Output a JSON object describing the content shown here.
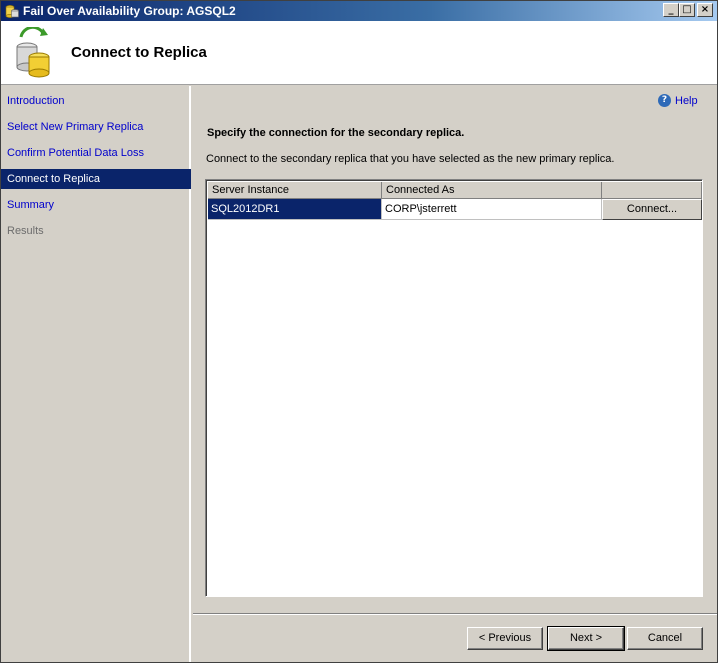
{
  "window": {
    "title": "Fail Over Availability Group: AGSQL2",
    "minimize": "_",
    "maximize": "□",
    "close": "×"
  },
  "header": {
    "title": "Connect to Replica",
    "icon": "database-wizard-icon"
  },
  "nav": {
    "items": [
      {
        "label": "Introduction"
      },
      {
        "label": "Select New Primary Replica"
      },
      {
        "label": "Confirm Potential Data Loss"
      },
      {
        "label": "Connect to Replica"
      },
      {
        "label": "Summary"
      },
      {
        "label": "Results"
      }
    ]
  },
  "content": {
    "help_label": "Help",
    "help_glyph": "?",
    "section_title": "Specify the connection for the secondary replica.",
    "section_desc": "Connect to the secondary replica that you have selected as the new primary replica.",
    "grid": {
      "columns": [
        "Server Instance",
        "Connected As",
        ""
      ],
      "rows": [
        {
          "server_instance": "SQL2012DR1",
          "connected_as": "CORP\\jsterrett",
          "action": "Connect..."
        }
      ]
    }
  },
  "buttons": {
    "previous": "< Previous",
    "next": "Next >",
    "cancel": "Cancel"
  },
  "colors": {
    "selection": "#0a246a",
    "link": "#0000cc",
    "dialog": "#d4d0c8"
  }
}
